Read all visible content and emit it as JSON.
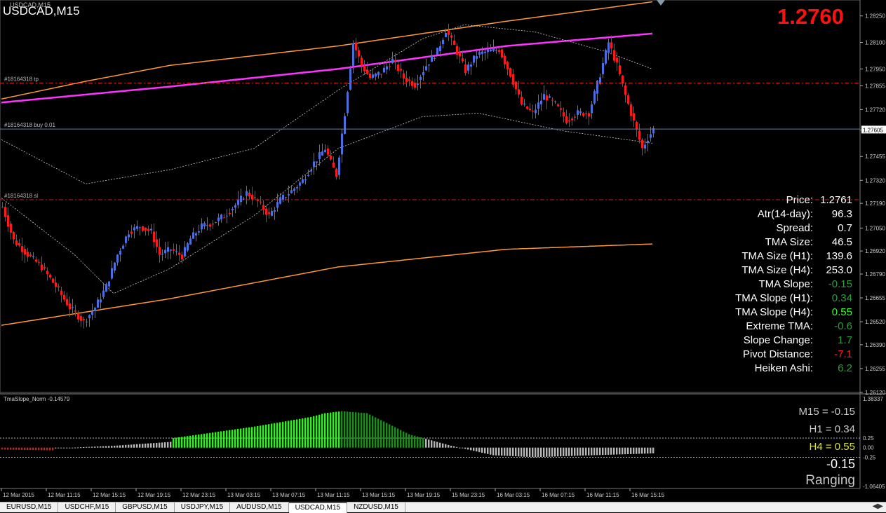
{
  "window": {
    "symbol_title": "USDCAD,M15",
    "subtitle": "USDCAD,M15"
  },
  "current_price_big": "1.2760",
  "order_levels": [
    {
      "label": "#18164318 tp",
      "price": 1.2787,
      "color": "#d02020"
    },
    {
      "label": "#18164318 buy 0.01",
      "price": 1.2761,
      "color": "#7080a0"
    },
    {
      "label": "#18164318 sl",
      "price": 1.2721,
      "color": "#d02020"
    }
  ],
  "stats": [
    {
      "label": "Price:",
      "value": "1.2761",
      "color": "#ffffff"
    },
    {
      "label": "Atr(14-day):",
      "value": "96.3",
      "color": "#ffffff"
    },
    {
      "label": "Spread:",
      "value": "0.7",
      "color": "#ffffff"
    },
    {
      "label": "TMA Size:",
      "value": "46.5",
      "color": "#ffffff"
    },
    {
      "label": "TMA Size (H1):",
      "value": "139.6",
      "color": "#ffffff"
    },
    {
      "label": "TMA Size (H4):",
      "value": "253.0",
      "color": "#ffffff"
    },
    {
      "label": "TMA Slope:",
      "value": "-0.15",
      "color": "#2e9e3e"
    },
    {
      "label": "TMA Slope (H1):",
      "value": "0.34",
      "color": "#2e9e3e"
    },
    {
      "label": "TMA Slope (H4):",
      "value": "0.55",
      "color": "#33ff33"
    },
    {
      "label": "Extreme TMA:",
      "value": "-0.6",
      "color": "#2e9e3e"
    },
    {
      "label": "Slope Change:",
      "value": "1.7",
      "color": "#2e9e3e"
    },
    {
      "label": "Pivot Distance:",
      "value": "-7.1",
      "color": "#ff2020"
    },
    {
      "label": "Heiken Ashi:",
      "value": "6.2",
      "color": "#2e9e3e"
    }
  ],
  "price_axis": {
    "labels": [
      "1.28250",
      "1.28100",
      "1.27950",
      "1.27855",
      "1.27720",
      "1.27605",
      "1.27455",
      "1.27320",
      "1.27190",
      "1.27050",
      "1.26920",
      "1.26790",
      "1.26655",
      "1.26520",
      "1.26390",
      "1.26255",
      "1.26120"
    ],
    "current_label": "1.27605",
    "ymin": 1.2612,
    "ymax": 1.2834
  },
  "subwindow": {
    "title": "TmaSlope_Norm -0.14579",
    "m15": "M15 = -0.15",
    "h1": "H1 = 0.34",
    "h4": "H4 = 0.55",
    "value": "-0.15",
    "state": "Ranging",
    "axis_labels": [
      "1.38337",
      "0.25",
      "0.00",
      "-0.25",
      "-1.06405"
    ],
    "ymin": -1.06405,
    "ymax": 1.38337
  },
  "time_axis": [
    "12 Mar 2015",
    "12 Mar 11:15",
    "12 Mar 15:15",
    "12 Mar 19:15",
    "12 Mar 23:15",
    "13 Mar 03:15",
    "13 Mar 07:15",
    "13 Mar 11:15",
    "13 Mar 15:15",
    "13 Mar 19:15",
    "15 Mar 23:15",
    "16 Mar 03:15",
    "16 Mar 07:15",
    "16 Mar 11:15",
    "16 Mar 15:15"
  ],
  "tabs": [
    "EURUSD,M15",
    "USDCHF,M15",
    "GBPUSD,M15",
    "USDJPY,M15",
    "AUDUSD,M15",
    "USDCAD,M15",
    "NZDUSD,M15"
  ],
  "active_tab": "USDCAD,M15",
  "colors": {
    "bull": "#4a6fe0",
    "bear": "#ff1a1a",
    "ma_magenta": "#ff33ff",
    "band_orange": "#ff9933",
    "hist_red": "#b03028",
    "hist_gray": "#b8b8b8",
    "hist_lime": "#33ee22",
    "hist_dark_green": "#1f8a1f"
  },
  "chart_data": {
    "type": "candlestick",
    "anchors": [
      [
        0,
        1.2717
      ],
      [
        4,
        1.2698
      ],
      [
        9,
        1.269
      ],
      [
        14,
        1.2683
      ],
      [
        19,
        1.2672
      ],
      [
        24,
        1.266
      ],
      [
        29,
        1.2652
      ],
      [
        33,
        1.266
      ],
      [
        37,
        1.2672
      ],
      [
        41,
        1.269
      ],
      [
        45,
        1.2703
      ],
      [
        49,
        1.2706
      ],
      [
        53,
        1.2703
      ],
      [
        56,
        1.269
      ],
      [
        60,
        1.2693
      ],
      [
        64,
        1.2689
      ],
      [
        67,
        1.2699
      ],
      [
        71,
        1.2706
      ],
      [
        75,
        1.2708
      ],
      [
        79,
        1.2712
      ],
      [
        83,
        1.2718
      ],
      [
        87,
        1.2725
      ],
      [
        91,
        1.272
      ],
      [
        95,
        1.2712
      ],
      [
        99,
        1.2721
      ],
      [
        103,
        1.2726
      ],
      [
        107,
        1.2732
      ],
      [
        111,
        1.2742
      ],
      [
        115,
        1.275
      ],
      [
        117,
        1.2742
      ],
      [
        119,
        1.2735
      ],
      [
        122,
        1.277
      ],
      [
        125,
        1.281
      ],
      [
        128,
        1.2797
      ],
      [
        131,
        1.279
      ],
      [
        135,
        1.2793
      ],
      [
        139,
        1.28
      ],
      [
        143,
        1.279
      ],
      [
        147,
        1.2786
      ],
      [
        151,
        1.2797
      ],
      [
        155,
        1.2805
      ],
      [
        158,
        1.2817
      ],
      [
        161,
        1.2808
      ],
      [
        165,
        1.2794
      ],
      [
        169,
        1.2803
      ],
      [
        173,
        1.2805
      ],
      [
        177,
        1.2806
      ],
      [
        181,
        1.2792
      ],
      [
        185,
        1.2775
      ],
      [
        189,
        1.277
      ],
      [
        193,
        1.278
      ],
      [
        197,
        1.2775
      ],
      [
        201,
        1.2766
      ],
      [
        205,
        1.277
      ],
      [
        209,
        1.277
      ],
      [
        213,
        1.2792
      ],
      [
        216,
        1.281
      ],
      [
        219,
        1.2797
      ],
      [
        222,
        1.278
      ],
      [
        225,
        1.2765
      ],
      [
        228,
        1.275
      ],
      [
        230,
        1.2756
      ],
      [
        232,
        1.2761
      ]
    ],
    "ma_magenta": [
      [
        0,
        1.2776
      ],
      [
        60,
        1.2785
      ],
      [
        120,
        1.2795
      ],
      [
        180,
        1.2808
      ],
      [
        232,
        1.2815
      ]
    ],
    "band_upper": [
      [
        0,
        1.2778
      ],
      [
        30,
        1.2788
      ],
      [
        60,
        1.2797
      ],
      [
        120,
        1.2808
      ],
      [
        180,
        1.2822
      ],
      [
        232,
        1.2833
      ]
    ],
    "band_lower": [
      [
        0,
        1.265
      ],
      [
        60,
        1.2665
      ],
      [
        120,
        1.2683
      ],
      [
        180,
        1.2693
      ],
      [
        232,
        1.2696
      ]
    ],
    "env_upper": [
      [
        0,
        1.2755
      ],
      [
        30,
        1.273
      ],
      [
        60,
        1.2738
      ],
      [
        90,
        1.275
      ],
      [
        120,
        1.2783
      ],
      [
        150,
        1.2812
      ],
      [
        165,
        1.282
      ],
      [
        190,
        1.2816
      ],
      [
        215,
        1.2805
      ],
      [
        232,
        1.2795
      ]
    ],
    "env_lower": [
      [
        0,
        1.2722
      ],
      [
        26,
        1.269
      ],
      [
        40,
        1.2668
      ],
      [
        60,
        1.2682
      ],
      [
        90,
        1.2712
      ],
      [
        120,
        1.275
      ],
      [
        150,
        1.2768
      ],
      [
        170,
        1.277
      ],
      [
        200,
        1.276
      ],
      [
        232,
        1.2753
      ]
    ],
    "slope_anchors": [
      [
        0,
        -0.05
      ],
      [
        18,
        -0.07
      ],
      [
        19,
        -0.02
      ],
      [
        40,
        0.05
      ],
      [
        60,
        0.15
      ],
      [
        61,
        0.25
      ],
      [
        90,
        0.55
      ],
      [
        110,
        0.8
      ],
      [
        115,
        0.9
      ],
      [
        121,
        0.95
      ],
      [
        130,
        0.9
      ],
      [
        145,
        0.35
      ],
      [
        160,
        0.05
      ],
      [
        175,
        -0.2
      ],
      [
        190,
        -0.25
      ],
      [
        210,
        -0.2
      ],
      [
        232,
        -0.15
      ]
    ]
  }
}
